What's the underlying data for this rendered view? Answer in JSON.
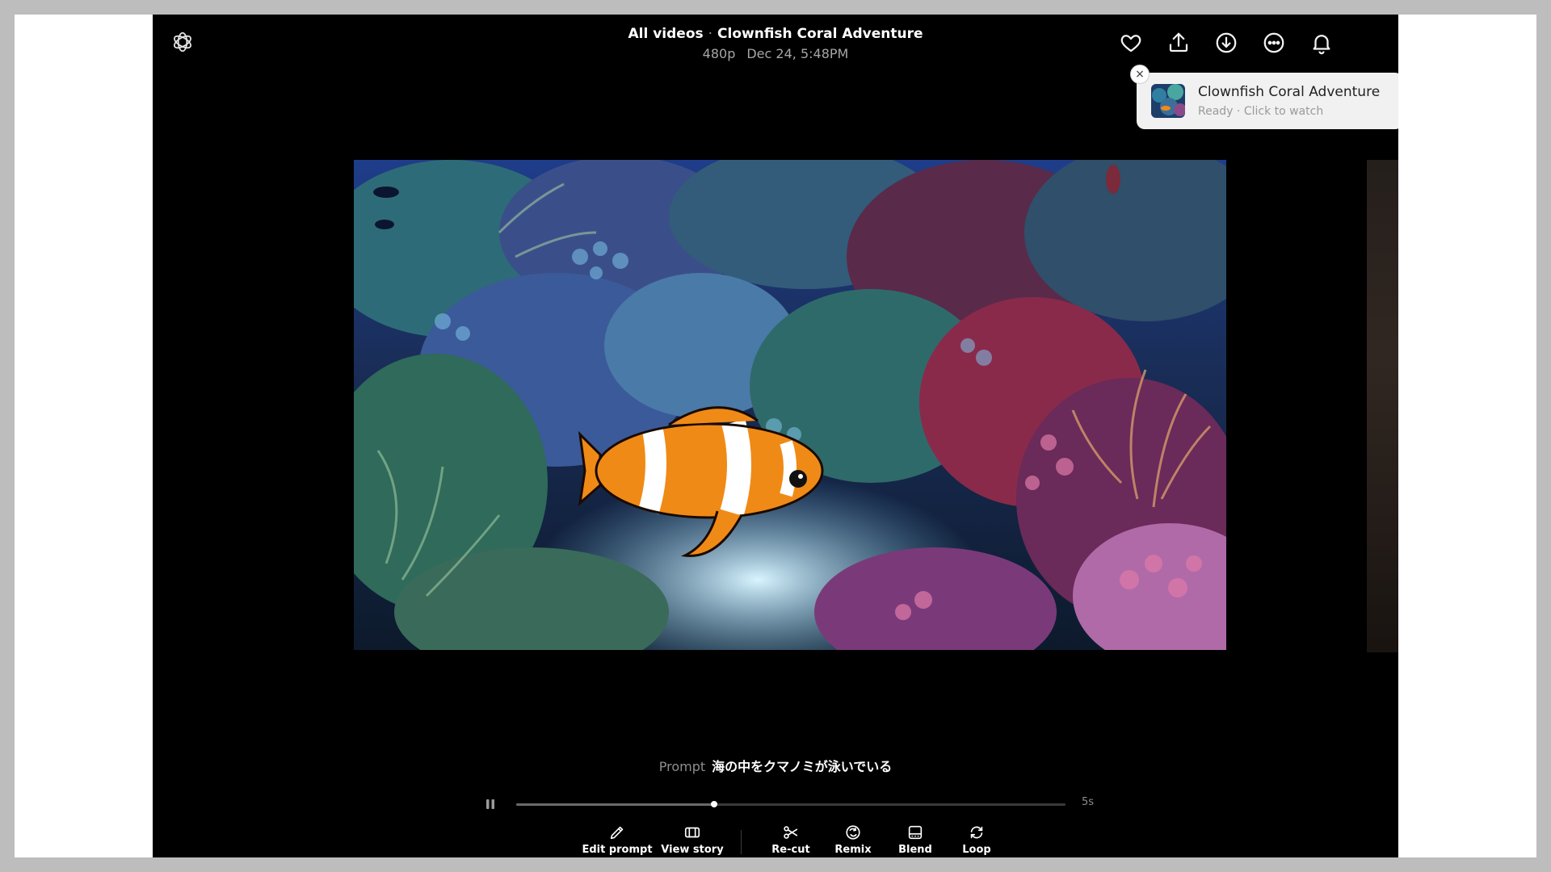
{
  "header": {
    "breadcrumb_root": "All videos",
    "breadcrumb_separator": "·",
    "title": "Clownfish Coral Adventure",
    "resolution": "480p",
    "date": "Dec 24, 5:48PM"
  },
  "icons": {
    "logo": "openai-logo-icon",
    "top": [
      "heart-icon",
      "share-upload-icon",
      "download-icon",
      "more-icon",
      "bell-icon"
    ]
  },
  "toast": {
    "close": "×",
    "title": "Clownfish Coral Adventure",
    "subtitle": "Ready · Click to watch"
  },
  "prompt": {
    "label": "Prompt",
    "text": "海の中をクマノミが泳いでいる"
  },
  "player": {
    "duration": "5s",
    "progress": 0.36
  },
  "actions": [
    {
      "label": "Edit prompt",
      "icon": "pencil-icon"
    },
    {
      "label": "View story",
      "icon": "storyboard-icon"
    },
    {
      "label": "Re-cut",
      "icon": "scissors-icon"
    },
    {
      "label": "Remix",
      "icon": "remix-icon"
    },
    {
      "label": "Blend",
      "icon": "blend-icon"
    },
    {
      "label": "Loop",
      "icon": "loop-icon"
    }
  ],
  "colors": {
    "app_bg": "#000000",
    "toast_bg": "#f1f1f1",
    "clownfish_orange": "#f08a16"
  }
}
